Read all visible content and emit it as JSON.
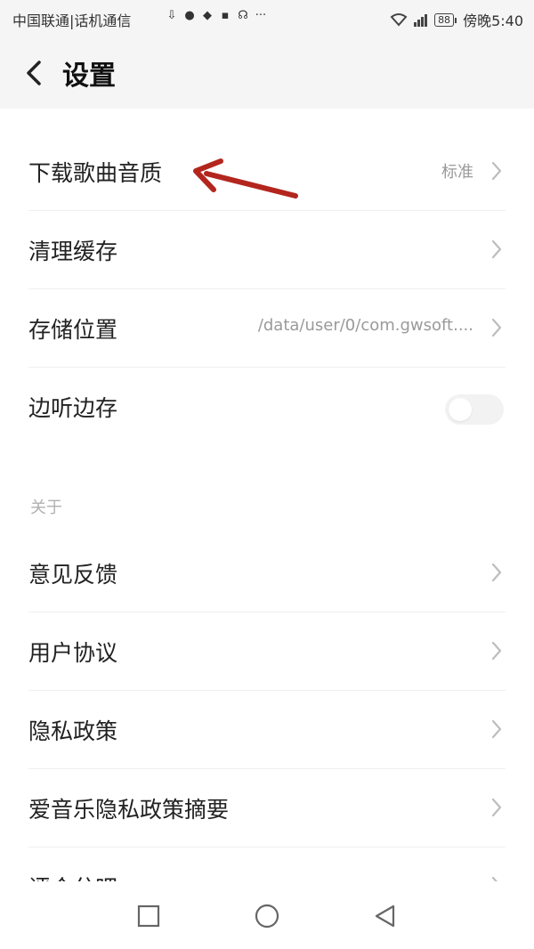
{
  "status_bar": {
    "carrier": "中国联通|话机通信",
    "notification_icons": [
      "download-icon",
      "chat-icon",
      "app-icon",
      "wallet-icon",
      "ghost-icon"
    ],
    "more": "···",
    "battery": "88",
    "time": "傍晚5:40"
  },
  "header": {
    "title": "设置"
  },
  "settings": {
    "quality": {
      "label": "下载歌曲音质",
      "value": "标准"
    },
    "cache": {
      "label": "清理缓存"
    },
    "storage": {
      "label": "存储位置",
      "value": "/data/user/0/com.gwsoft...."
    },
    "listen_save": {
      "label": "边听边存",
      "enabled": false
    }
  },
  "about": {
    "header": "关于",
    "items": [
      {
        "label": "意见反馈"
      },
      {
        "label": "用户协议"
      },
      {
        "label": "隐私政策"
      },
      {
        "label": "爱音乐隐私政策摘要"
      },
      {
        "label": "评个分吧"
      }
    ]
  },
  "colors": {
    "annotation_arrow": "#b3261e",
    "secondary_text": "#9a9a9a"
  }
}
